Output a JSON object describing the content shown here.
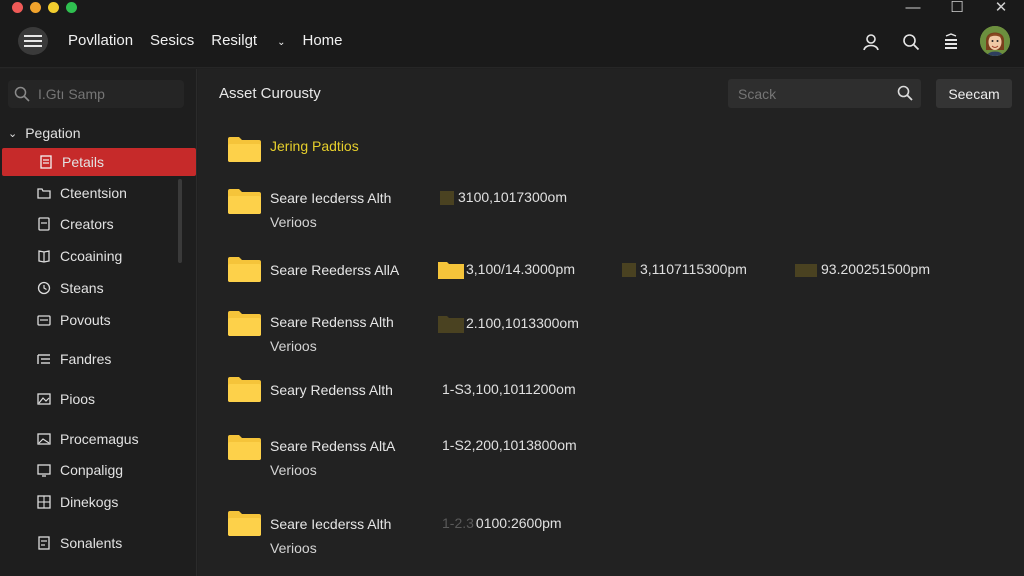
{
  "colors": {
    "accent_active": "#c62a2a",
    "folder": "#f5c43a",
    "highlight_text": "#e6cf2c",
    "traffic_red": "#ef5a57",
    "traffic_orange": "#f1a32c",
    "traffic_yellow": "#f2cd2e",
    "traffic_green": "#2fc050"
  },
  "nav": {
    "items": [
      "Povllation",
      "Sesics",
      "Resilgt",
      "Home"
    ]
  },
  "sidebar": {
    "search_placeholder": "I.Gtı Samp",
    "heading": "Pegation",
    "items": [
      {
        "label": "Petails",
        "icon": "document-icon"
      },
      {
        "label": "Cteentsion",
        "icon": "folder-icon"
      },
      {
        "label": "Creators",
        "icon": "document-icon"
      },
      {
        "label": "Ccoaining",
        "icon": "book-icon"
      },
      {
        "label": "Steans",
        "icon": "clock-icon"
      },
      {
        "label": "Povouts",
        "icon": "card-icon"
      },
      {
        "label": "Fandres",
        "icon": "list-icon"
      },
      {
        "label": "Pioos",
        "icon": "image-icon"
      },
      {
        "label": "Procemagus",
        "icon": "image-icon"
      },
      {
        "label": "Conpaligg",
        "icon": "monitor-icon"
      },
      {
        "label": "Dinekogs",
        "icon": "grid-icon"
      },
      {
        "label": "Sonalents",
        "icon": "document-icon"
      }
    ]
  },
  "main": {
    "title": "Asset Curousty",
    "search_placeholder": "Scack",
    "search_button": "Seecam",
    "rows": [
      {
        "name": "Jering Padtios",
        "sub": "",
        "highlight": true,
        "meta": []
      },
      {
        "name": "Seare Iecderss Alth",
        "sub": "Verioos",
        "highlight": false,
        "meta": [
          "3100,1017300om"
        ]
      },
      {
        "name": "Seare Reederss AllA",
        "sub": "",
        "highlight": false,
        "meta": [
          "3,100/14.3000pm",
          "3,1107115300pm",
          "93.200251500pm"
        ]
      },
      {
        "name": "Seare Redenss Alth",
        "sub": "Verioos",
        "highlight": false,
        "meta": [
          "2.100,1013300om"
        ]
      },
      {
        "name": "Seary Redenss Alth",
        "sub": "",
        "highlight": false,
        "meta": [
          "1-S3,100,1011200om"
        ]
      },
      {
        "name": "Seare Redenss AltA",
        "sub": "Verioos",
        "highlight": false,
        "meta": [
          "1-S2,200,1013800om"
        ]
      },
      {
        "name": "Seare Iecderss Alth",
        "sub": "Verioos",
        "highlight": false,
        "meta": [
          "0100:2600pm"
        ]
      }
    ]
  }
}
